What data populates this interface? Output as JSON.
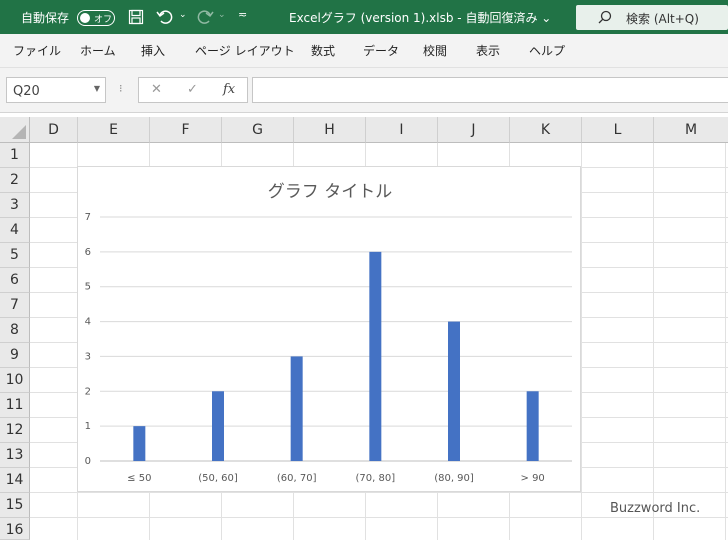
{
  "titlebar": {
    "autosave_label": "自動保存",
    "autosave_state": "オフ",
    "document_title": "Excelグラフ (version 1).xlsb  -  自動回復済み  ⌄",
    "search_label": "検索 (Alt+Q)"
  },
  "menu": [
    "ファイル",
    "ホーム",
    "挿入",
    "ページ レイアウト",
    "数式",
    "データ",
    "校閲",
    "表示",
    "ヘルプ"
  ],
  "formula_bar": {
    "name_box": "Q20",
    "formula": ""
  },
  "columns": [
    "D",
    "E",
    "F",
    "G",
    "H",
    "I",
    "J",
    "K",
    "L",
    "M"
  ],
  "rows": [
    "1",
    "2",
    "3",
    "4",
    "5",
    "6",
    "7",
    "8",
    "9",
    "10",
    "11",
    "12",
    "13",
    "14",
    "15",
    "16"
  ],
  "chart_data": {
    "type": "bar",
    "title": "グラフ タイトル",
    "categories": [
      "≤ 50",
      "(50, 60]",
      "(60, 70]",
      "(70, 80]",
      "(80, 90]",
      "> 90"
    ],
    "values": [
      1,
      2,
      3,
      6,
      4,
      2
    ],
    "ylim": [
      0,
      7
    ],
    "yticks": [
      "0",
      "1",
      "2",
      "3",
      "4",
      "5",
      "6",
      "7"
    ],
    "grid": true,
    "bar_color": "#4472c4"
  },
  "watermark": "Buzzword Inc."
}
